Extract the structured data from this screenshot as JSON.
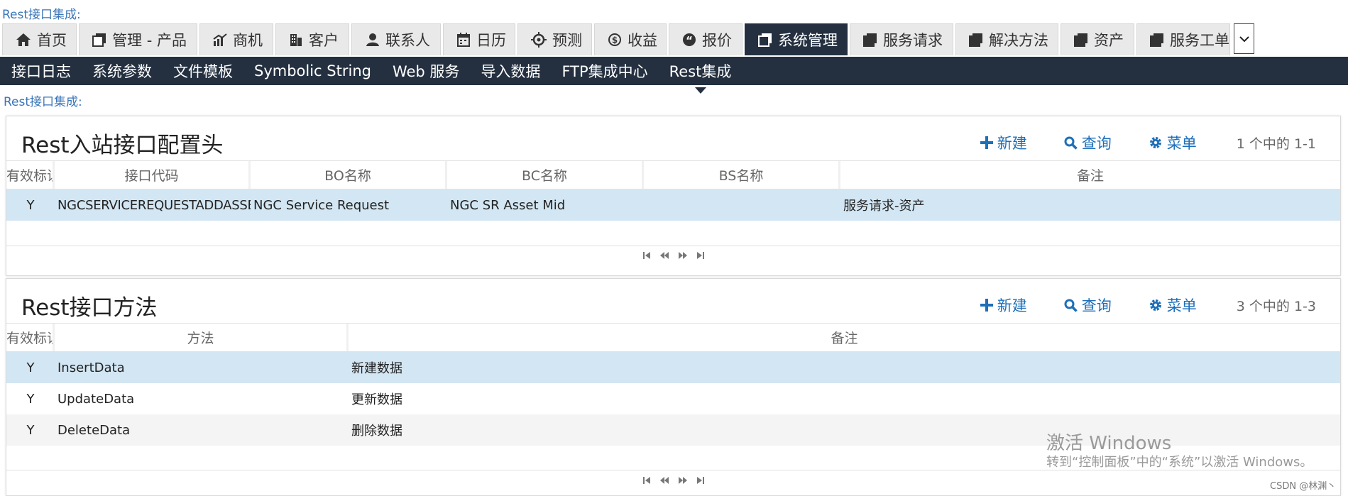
{
  "breadcrumb_top": "Rest接口集成:",
  "tabs": [
    {
      "label": "首页",
      "icon": "home-icon"
    },
    {
      "label": "管理 - 产品",
      "icon": "square-icon"
    },
    {
      "label": "商机",
      "icon": "chart-icon"
    },
    {
      "label": "客户",
      "icon": "building-icon"
    },
    {
      "label": "联系人",
      "icon": "person-icon"
    },
    {
      "label": "日历",
      "icon": "calendar-icon"
    },
    {
      "label": "预测",
      "icon": "target-icon"
    },
    {
      "label": "收益",
      "icon": "dollar-icon"
    },
    {
      "label": "报价",
      "icon": "quote-icon"
    },
    {
      "label": "系统管理",
      "icon": "square-icon",
      "active": true
    },
    {
      "label": "服务请求",
      "icon": "square-icon"
    },
    {
      "label": "解决方法",
      "icon": "square-icon"
    },
    {
      "label": "资产",
      "icon": "square-icon"
    },
    {
      "label": "服务工单",
      "icon": "square-icon"
    }
  ],
  "tabs_more": "⌄",
  "subnav": [
    "接口日志",
    "系统参数",
    "文件模板",
    "Symbolic String",
    "Web 服务",
    "导入数据",
    "FTP集成中心",
    "Rest集成"
  ],
  "breadcrumb_2": "Rest接口集成:",
  "panel1": {
    "title": "Rest入站接口配置头",
    "new_label": "新建",
    "query_label": "查询",
    "menu_label": "菜单",
    "count": "1 个中的 1-1",
    "headers": [
      "有效标识",
      "接口代码",
      "BO名称",
      "BC名称",
      "BS名称",
      "备注"
    ],
    "rows": [
      [
        "Y",
        "NGCSERVICEREQUESTADDASSET",
        "NGC Service Request",
        "NGC SR Asset Mid",
        "",
        "服务请求-资产"
      ]
    ]
  },
  "panel2": {
    "title": "Rest接口方法",
    "new_label": "新建",
    "query_label": "查询",
    "menu_label": "菜单",
    "count": "3 个中的 1-3",
    "headers": [
      "有效标识",
      "方法",
      "备注"
    ],
    "rows": [
      [
        "Y",
        "InsertData",
        "新建数据"
      ],
      [
        "Y",
        "UpdateData",
        "更新数据"
      ],
      [
        "Y",
        "DeleteData",
        "删除数据"
      ]
    ]
  },
  "watermark_line1": "激活 Windows",
  "watermark_line2": "转到“控制面板”中的“系统”以激活 Windows。",
  "csdn": "CSDN @林渊丶",
  "colors": {
    "nav_dark": "#243040",
    "link_blue": "#1d6fb8",
    "selected_row": "#d3e6f3"
  }
}
